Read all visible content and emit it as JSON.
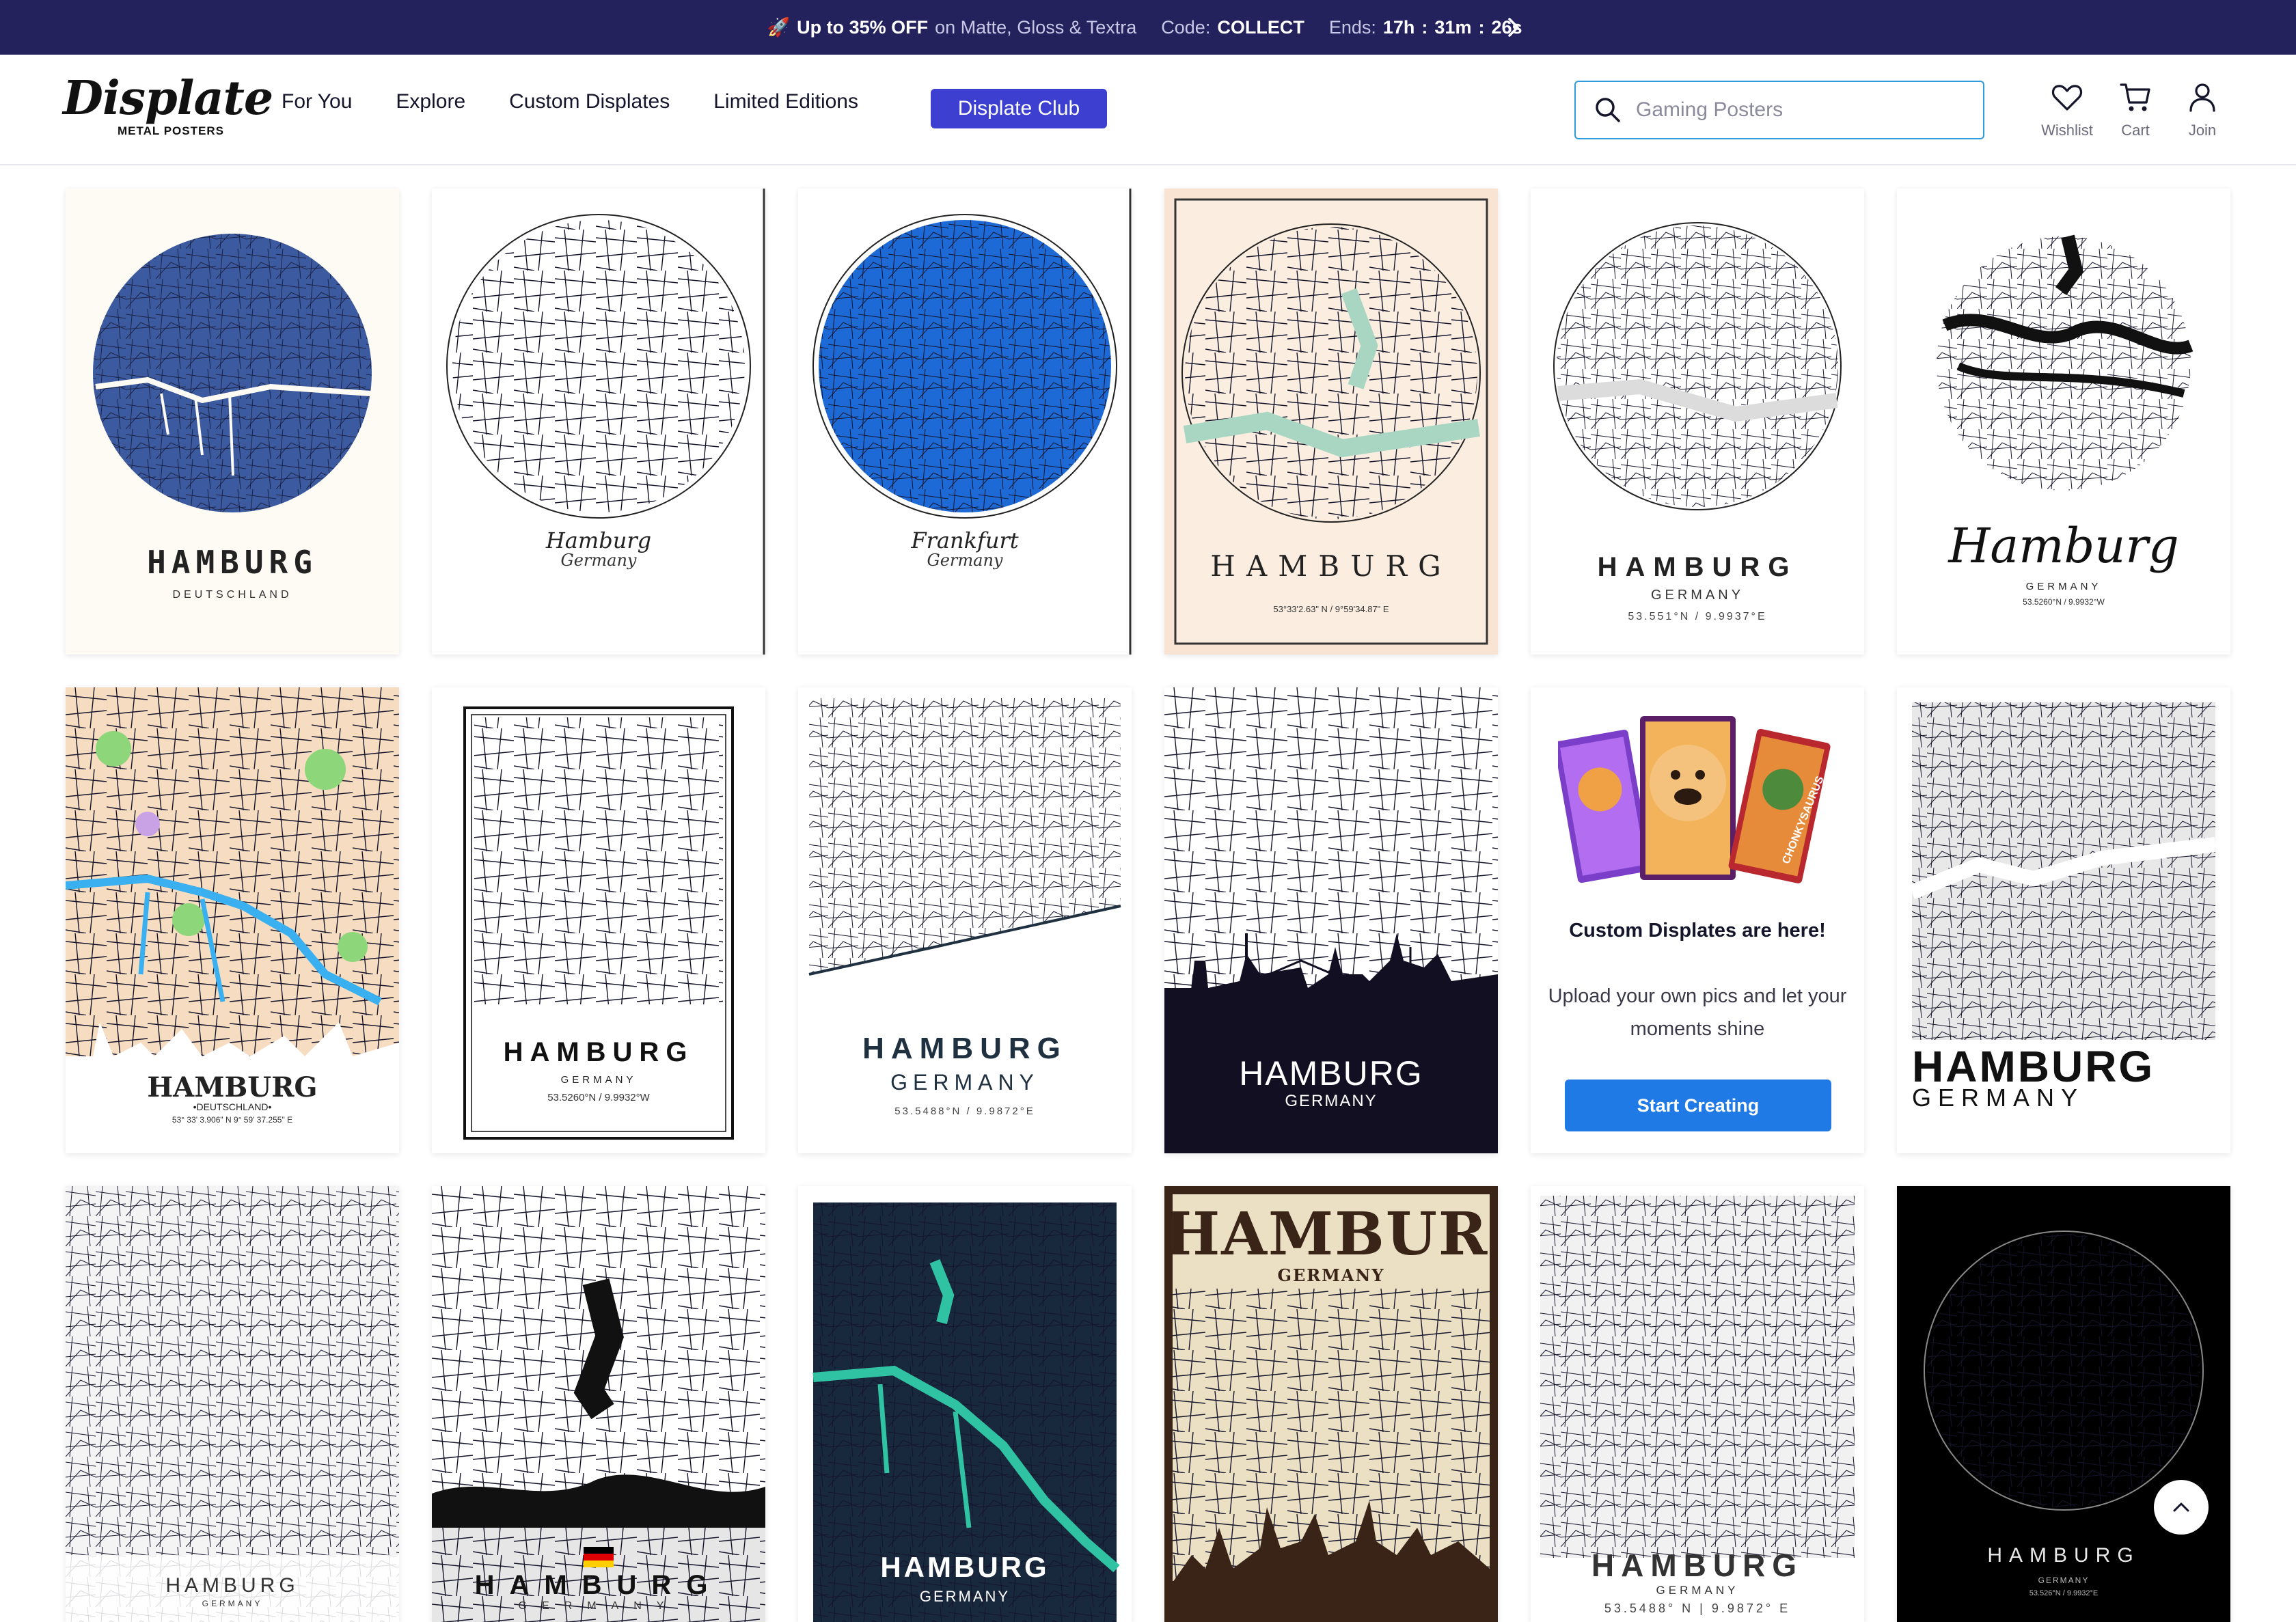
{
  "promo": {
    "emoji": "🚀",
    "offer": "Up to 35% OFF",
    "on_text": "on Matte, Gloss & Textra",
    "code_label": "Code:",
    "code": "COLLECT",
    "ends_label": "Ends:",
    "hours": "17h",
    "minutes": "31m",
    "seconds": "26s"
  },
  "logo": {
    "name": "Displate",
    "tagline": "METAL POSTERS"
  },
  "nav": [
    "For You",
    "Explore",
    "Custom Displates",
    "Limited Editions"
  ],
  "club_label": "Displate Club",
  "search": {
    "placeholder": "Gaming Posters"
  },
  "header_icons": [
    {
      "icon": "heart-icon",
      "label": "Wishlist"
    },
    {
      "icon": "cart-icon",
      "label": "Cart"
    },
    {
      "icon": "user-icon",
      "label": "Join"
    }
  ],
  "posters": {
    "p1": {
      "title": "HAMBURG",
      "subtitle": "DEUTSCHLAND"
    },
    "p2": {
      "title": "Hamburg",
      "subtitle": "Germany"
    },
    "p3": {
      "title": "Frankfurt",
      "subtitle": "Germany"
    },
    "p4": {
      "title": "HAMBURG",
      "coords": "53°33'2.63\" N / 9°59'34.87\" E"
    },
    "p5": {
      "title": "HAMBURG",
      "subtitle": "GERMANY",
      "coords": "53.551°N / 9.9937°E"
    },
    "p6": {
      "title": "Hamburg",
      "subtitle": "GERMANY",
      "coords": "53.5260°N / 9.9932°W"
    },
    "p7": {
      "title": "HAMBURG",
      "subtitle": "•DEUTSCHLAND•",
      "coords": "53° 33' 3.906\" N 9° 59' 37.255\" E"
    },
    "p8": {
      "title": "HAMBURG",
      "subtitle": "GERMANY",
      "coords": "53.5260°N / 9.9932°W"
    },
    "p9": {
      "title": "HAMBURG",
      "subtitle": "GERMANY",
      "coords": "53.5488°N / 9.9872°E"
    },
    "p10": {
      "title": "HAMBURG",
      "subtitle": "GERMANY"
    },
    "p12": {
      "title": "HAMBURG",
      "subtitle": "GERMANY"
    },
    "p13": {
      "title": "HAMBURG",
      "subtitle": "GERMANY"
    },
    "p14": {
      "title": "HAMBURG",
      "subtitle": "GERMANY"
    },
    "p15": {
      "title": "HAMBURG",
      "subtitle": "GERMANY"
    },
    "p16": {
      "title": "HAMBURG",
      "subtitle": "GERMANY"
    },
    "p17": {
      "title": "HAMBURG",
      "subtitle": "GERMANY",
      "coords": "53.5488° N | 9.9872° E"
    },
    "p18": {
      "title": "HAMBURG",
      "subtitle": "GERMANY",
      "coords": "53.526°N / 9.9932°E"
    }
  },
  "custom_promo": {
    "title": "Custom Displates are here!",
    "description": "Upload your own pics and let your moments shine",
    "button": "Start Creating",
    "side_text": "CHONKYSAURUS"
  },
  "colors": {
    "promo_bar": "#24225c",
    "club_button": "#3c3fd0",
    "search_border": "#2d9bdc",
    "cta_button": "#1f7ae6"
  }
}
